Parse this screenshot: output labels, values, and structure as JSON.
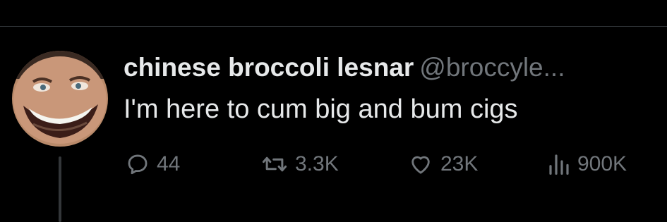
{
  "tweet": {
    "display_name": "chinese broccoli lesnar",
    "handle": "@broccyle...",
    "text": "I'm here to cum big and bum cigs",
    "avatar_icon": "avatar-photo"
  },
  "actions": {
    "reply": {
      "icon": "reply-icon",
      "count": "44"
    },
    "retweet": {
      "icon": "retweet-icon",
      "count": "3.3K"
    },
    "like": {
      "icon": "heart-icon",
      "count": "23K"
    },
    "views": {
      "icon": "views-icon",
      "count": "900K"
    }
  },
  "colors": {
    "background": "#000000",
    "primary_text": "#e7e9ea",
    "secondary_text": "#71767b",
    "divider": "#2f3336"
  }
}
